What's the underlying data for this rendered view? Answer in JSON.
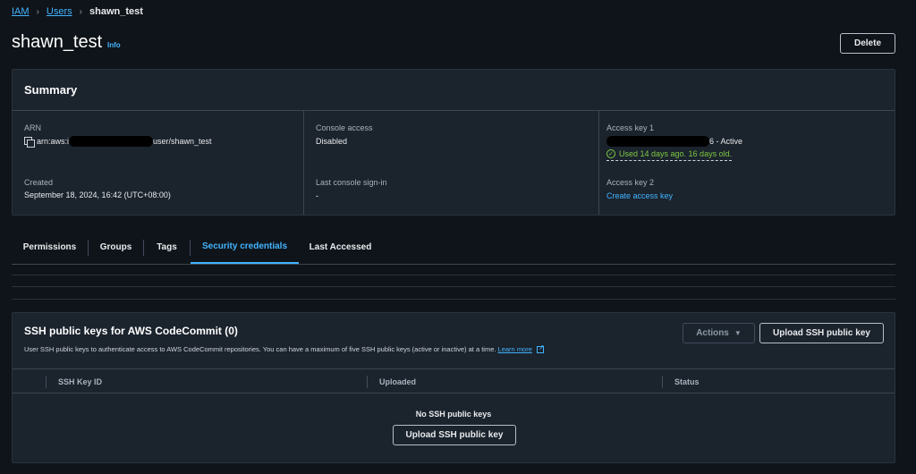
{
  "breadcrumb": {
    "root": "IAM",
    "parent": "Users",
    "current": "shawn_test"
  },
  "header": {
    "title": "shawn_test",
    "info": "Info",
    "delete_label": "Delete"
  },
  "summary": {
    "title": "Summary",
    "arn_label": "ARN",
    "arn_prefix": "arn:aws:i",
    "arn_suffix": "user/shawn_test",
    "created_label": "Created",
    "created_value": "September 18, 2024, 16:42 (UTC+08:00)",
    "console_access_label": "Console access",
    "console_access_value": "Disabled",
    "last_signin_label": "Last console sign-in",
    "last_signin_value": "-",
    "access_key1_label": "Access key 1",
    "access_key1_suffix": "6 - Active",
    "access_key1_status": "Used 14 days ago. 16 days old.",
    "access_key2_label": "Access key 2",
    "access_key2_link": "Create access key"
  },
  "tabs": [
    {
      "label": "Permissions",
      "active": false
    },
    {
      "label": "Groups",
      "active": false
    },
    {
      "label": "Tags",
      "active": false
    },
    {
      "label": "Security credentials",
      "active": true
    },
    {
      "label": "Last Accessed",
      "active": false
    }
  ],
  "ssh": {
    "title": "SSH public keys for AWS CodeCommit (0)",
    "description": "User SSH public keys to authenticate access to AWS CodeCommit repositories. You can have a maximum of five SSH public keys (active or inactive) at a time.",
    "learn_more": "Learn more",
    "actions_label": "Actions",
    "upload_label": "Upload SSH public key",
    "columns": [
      "SSH Key ID",
      "Uploaded",
      "Status"
    ],
    "empty_text": "No SSH public keys",
    "empty_upload_label": "Upload SSH public key"
  },
  "colors": {
    "accent": "#42b4ff",
    "success": "#7dc843",
    "background": "#0f141a",
    "panel": "#1b232d"
  }
}
